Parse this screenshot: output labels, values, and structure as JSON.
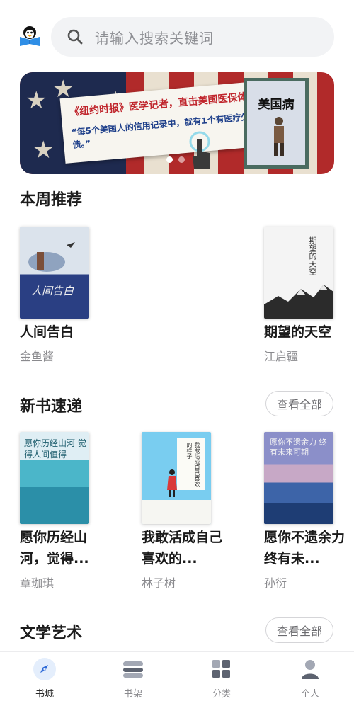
{
  "search": {
    "placeholder": "请输入搜索关键词"
  },
  "banner": {
    "headline": "《纽约时报》医学记者，直击美国医保体制之痛！",
    "quote": "“每5个美国人的信用记录中，就有1个有医疗欠债。”",
    "book_cover_title": "美国病",
    "slide_count": 2,
    "active_slide": 1
  },
  "sections": {
    "weekly": {
      "title": "本周推荐",
      "books": [
        {
          "title": "人间告白",
          "author": "金鱼酱",
          "cover_text": "人间告白"
        },
        {
          "title": "期望的天空",
          "author": "江启疆",
          "cover_text": "期望的天空"
        }
      ]
    },
    "new_books": {
      "title": "新书速递",
      "see_all": "查看全部",
      "books": [
        {
          "title": "愿你历经山河，觉得...",
          "author": "章珈琪",
          "cover_text": "愿你历经山河 觉得人间值得"
        },
        {
          "title": "我敢活成自己喜欢的...",
          "author": "林子树",
          "cover_text": "我敢活成自己喜欢的样子"
        },
        {
          "title": "愿你不遗余力 终有未...",
          "author": "孙衍",
          "cover_text": "愿你不遗余力 终有未来可期"
        }
      ]
    },
    "literature": {
      "title": "文学艺术",
      "see_all": "查看全部"
    }
  },
  "tabbar": {
    "items": [
      {
        "label": "书城",
        "icon": "compass-icon",
        "active": true
      },
      {
        "label": "书架",
        "icon": "bookshelf-icon",
        "active": false
      },
      {
        "label": "分类",
        "icon": "category-grid-icon",
        "active": false
      },
      {
        "label": "个人",
        "icon": "person-icon",
        "active": false
      }
    ]
  },
  "colors": {
    "accent_blue": "#2f6bd8",
    "active_tab_bg": "#e4eefc",
    "muted_text": "#8a8a8e"
  }
}
